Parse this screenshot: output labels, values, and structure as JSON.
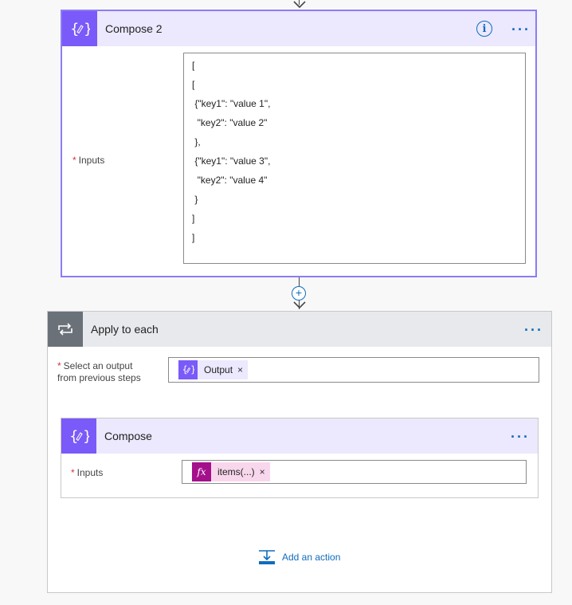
{
  "compose2": {
    "title": "Compose 2",
    "inputs_label": "Inputs",
    "code_lines": [
      "[",
      "[",
      " {\"key1\": \"value 1\",",
      "  \"key2\": \"value 2\"",
      " },",
      " {\"key1\": \"value 3\",",
      "  \"key2\": \"value 4\"",
      " }",
      "]",
      "]"
    ]
  },
  "apply_to_each": {
    "title": "Apply to each",
    "select_label_line1": "Select an output",
    "select_label_line2": "from previous steps",
    "token_label": "Output",
    "token_remove": "×"
  },
  "compose": {
    "title": "Compose",
    "inputs_label": "Inputs",
    "token_label": "items(...)",
    "token_remove": "×"
  },
  "add_action_label": "Add an action",
  "colors": {
    "compose_accent": "#7a5af8",
    "expression_accent": "#a4108c",
    "link_blue": "#0f6cbd",
    "required_red": "#d13438"
  }
}
